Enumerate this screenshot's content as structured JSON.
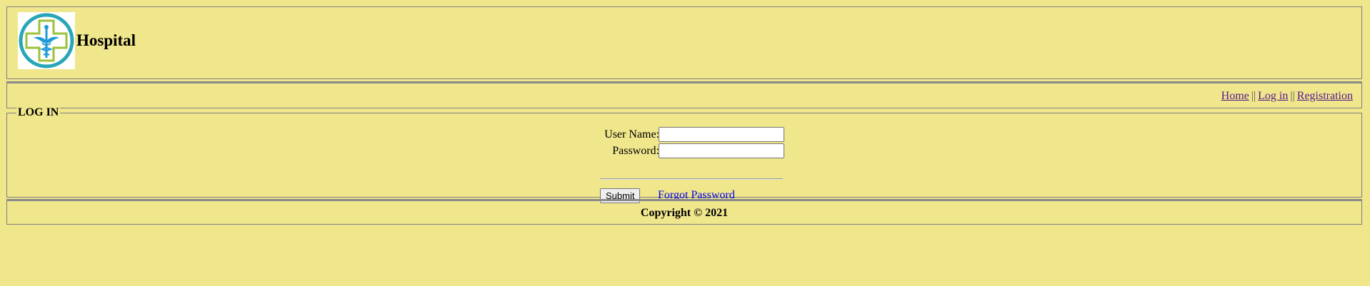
{
  "header": {
    "site_title": "Hospital",
    "logo_icon": "hospital-cross-caduceus-icon"
  },
  "nav": {
    "links": [
      {
        "label": "Home"
      },
      {
        "label": "Log in"
      },
      {
        "label": "Registration"
      }
    ],
    "separator": "||"
  },
  "login": {
    "legend": "LOG IN",
    "username_label": "User Name:",
    "username_value": "",
    "password_label": "Password:",
    "password_value": "",
    "submit_label": "Submit",
    "forgot_label": "Forgot Password"
  },
  "footer": {
    "copyright": "Copyright © 2021"
  },
  "colors": {
    "background": "#F0E68C",
    "border": "#808080",
    "visited_link": "#551A8B",
    "link": "#0000EE",
    "logo_ring": "#27A6B8",
    "logo_cross": "#9CC23B",
    "logo_symbol": "#1E9BD7"
  }
}
